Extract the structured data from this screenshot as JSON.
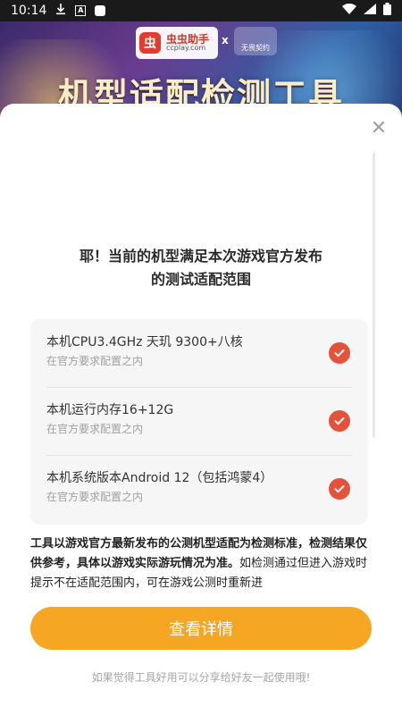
{
  "status_bar": {
    "time": "10:14",
    "a_label": "A"
  },
  "banner": {
    "logo_cn": "虫虫助手",
    "logo_en": "ccplay.com",
    "x": "x",
    "partner": "无畏契约",
    "title": "机型适配检测工具"
  },
  "sheet": {
    "headline_line1": "耶！当前的机型满足本次游戏官方发布",
    "headline_line2": "的测试适配范围",
    "items": [
      {
        "title": "本机CPU3.4GHz 天玑 9300+八核",
        "sub": "在官方要求配置之内"
      },
      {
        "title": "本机运行内存16+12G",
        "sub": "在官方要求配置之内"
      },
      {
        "title": "本机系统版本Android 12（包括鸿蒙4）",
        "sub": "在官方要求配置之内"
      }
    ],
    "desc_bold": "工具以游戏官方最新发布的公测机型适配为检测标准，检测结果仅供参考，具体以游戏实际游玩情况为准。",
    "desc_normal": "如检测通过但进入游戏时提示不在适配范围内，可在游戏公测时重新进",
    "button_label": "查看详情",
    "footer_hint": "如果觉得工具好用可以分享给好友一起使用哦!"
  },
  "colors": {
    "accent": "#f5a623",
    "check": "#e5523c"
  }
}
